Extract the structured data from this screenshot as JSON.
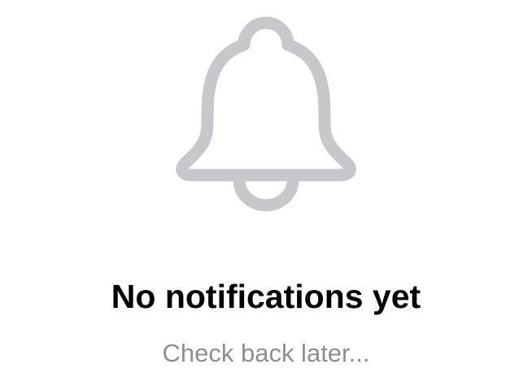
{
  "empty_state": {
    "icon": "bell-icon",
    "title": "No notifications yet",
    "subtitle": "Check back later...",
    "icon_color": "#c7c7cc",
    "title_color": "#000000",
    "subtitle_color": "#8e8e93"
  }
}
